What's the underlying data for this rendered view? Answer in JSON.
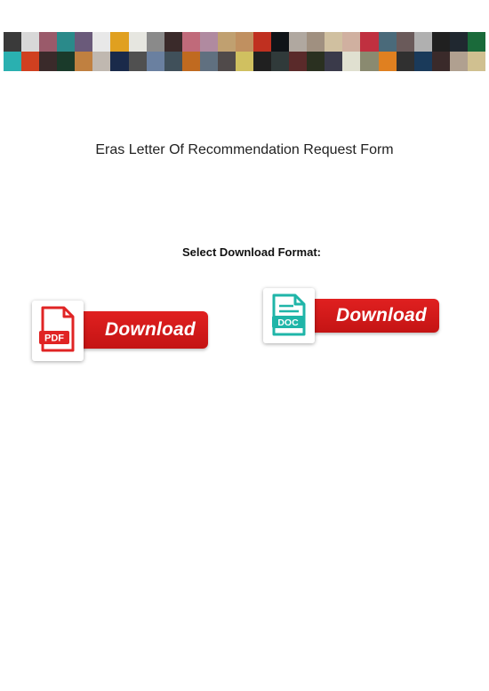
{
  "banner": {
    "description": "movie poster thumbnail mosaic",
    "tile_colors": [
      "#3a3a3a",
      "#d8d8d8",
      "#9a5a6a",
      "#2a8a8a",
      "#6a5a7a",
      "#e8e8e8",
      "#e0a020",
      "#e6e6e0",
      "#8a8a8a",
      "#3a2a2a",
      "#c06a7a",
      "#b08aa0",
      "#c0a070",
      "#c09060",
      "#c03020",
      "#101418",
      "#b0a8a0",
      "#a09080",
      "#d0c0a0",
      "#d0b0a0",
      "#c03040",
      "#4a6a7a",
      "#6a5a5a",
      "#b0b0b0",
      "#202020",
      "#202830",
      "#1a6a3a",
      "#2ab0b0",
      "#d04020",
      "#3a2a2a",
      "#1a3a2a",
      "#c08040",
      "#c0b8b0",
      "#1a2a4a",
      "#505050",
      "#6a80a0",
      "#40505a",
      "#c06a20",
      "#607080",
      "#504a4a",
      "#d0c060",
      "#202020",
      "#303a3a",
      "#5a2a2a",
      "#2a3020",
      "#3a3a4a",
      "#e0e0d0",
      "#8a8a70",
      "#e08020",
      "#303030",
      "#1a3a5a",
      "#3a2a2a",
      "#b0a090",
      "#d0c090"
    ]
  },
  "document": {
    "title": "Eras Letter Of Recommendation Request Form"
  },
  "download": {
    "label": "Select Download Format:",
    "options": [
      {
        "format": "PDF",
        "button_label": "Download",
        "icon": "pdf-file-icon",
        "icon_color": "#e02424"
      },
      {
        "format": "DOC",
        "button_label": "Download",
        "icon": "doc-file-icon",
        "icon_color": "#1fb5a8"
      }
    ],
    "button_color": "#d41a1a"
  }
}
